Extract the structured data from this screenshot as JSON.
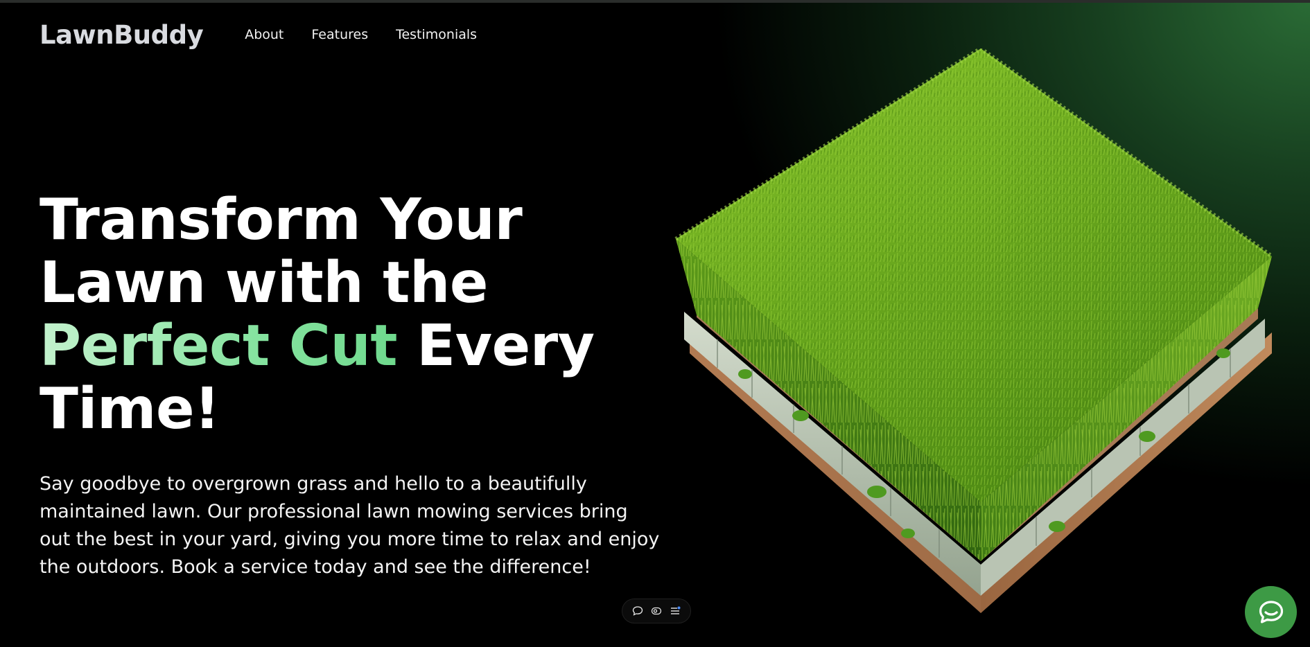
{
  "brand": {
    "name": "LawnBuddy"
  },
  "nav": {
    "links": [
      {
        "label": "About"
      },
      {
        "label": "Features"
      },
      {
        "label": "Testimonials"
      }
    ]
  },
  "hero": {
    "title_part1_line1": "Transform Your",
    "title_part1_line2": "Lawn with the",
    "title_accent": "Perfect Cut",
    "title_part2": " Every",
    "title_part3": "Time!",
    "description": "Say goodbye to overgrown grass and hello to a beautifully maintained lawn. Our professional lawn mowing services bring out the best in your yard, giving you more time to relax and enjoy the outdoors. Book a service today and see the difference!"
  },
  "illustration": {
    "icon": "isometric-grass-tile"
  },
  "toolbar": {
    "icons": [
      "comment-icon",
      "eye-icon",
      "list-icon"
    ]
  },
  "chat": {
    "icon": "chat-bubble-icon"
  },
  "colors": {
    "accent_light": "#c3f2cd",
    "accent": "#6fd98d",
    "chat_button": "#3d9a45",
    "background_glow": "#2a6b35"
  }
}
